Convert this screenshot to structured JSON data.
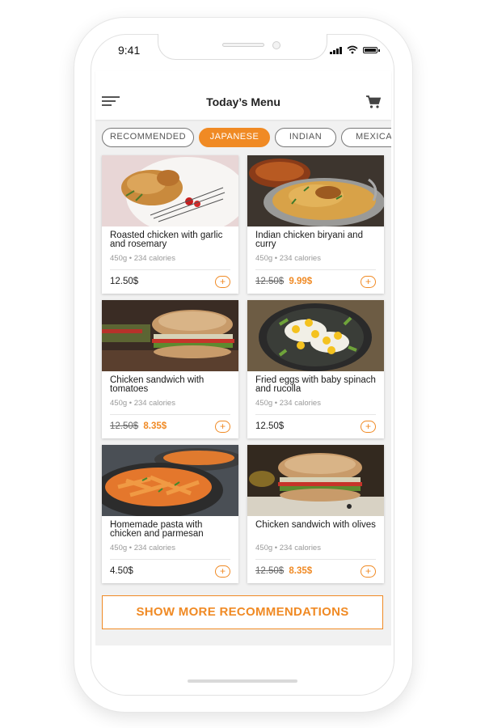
{
  "status_bar": {
    "time": "9:41"
  },
  "header": {
    "title": "Today’s Menu"
  },
  "icons": {
    "menu": "hamburger-menu-icon",
    "cart": "shopping-cart-icon",
    "add": "plus-circle-icon"
  },
  "colors": {
    "accent": "#f08a24",
    "background": "#f1f1f1",
    "text": "#222222",
    "muted": "#999999"
  },
  "tabs": [
    {
      "label": "RECOMMENDED",
      "active": false
    },
    {
      "label": "JAPANESE",
      "active": true
    },
    {
      "label": "INDIAN",
      "active": false
    },
    {
      "label": "MEXICAN",
      "active": false
    }
  ],
  "dishes": [
    {
      "name": "Roasted chicken with garlic and rosemary",
      "meta": "450g • 234 calories",
      "price": "12.50$",
      "old_price": "",
      "new_price": ""
    },
    {
      "name": "Indian chicken biryani and curry",
      "meta": "450g • 234 calories",
      "price": "",
      "old_price": "12.50$",
      "new_price": "9.99$"
    },
    {
      "name": "Chicken sandwich with tomatoes",
      "meta": "450g • 234 calories",
      "price": "",
      "old_price": "12.50$",
      "new_price": "8.35$"
    },
    {
      "name": "Fried eggs with baby spinach and rucolla",
      "meta": "450g • 234 calories",
      "price": "12.50$",
      "old_price": "",
      "new_price": ""
    },
    {
      "name": "Homemade pasta with chicken and parmesan",
      "meta": "450g • 234 calories",
      "price": "4.50$",
      "old_price": "",
      "new_price": ""
    },
    {
      "name": "Chicken sandwich with olives",
      "meta": "450g • 234 calories",
      "price": "",
      "old_price": "12.50$",
      "new_price": "8.35$"
    }
  ],
  "footer": {
    "more_label": "SHOW MORE RECOMMENDATIONS"
  }
}
